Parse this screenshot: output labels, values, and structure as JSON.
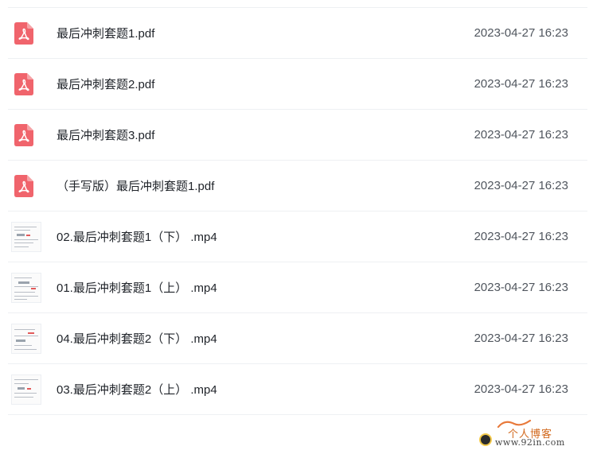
{
  "files": [
    {
      "type": "pdf",
      "icon": "pdf-file-icon",
      "name": "最后冲刺套题1.pdf",
      "date": "2023-04-27 16:23"
    },
    {
      "type": "pdf",
      "icon": "pdf-file-icon",
      "name": "最后冲刺套题2.pdf",
      "date": "2023-04-27 16:23"
    },
    {
      "type": "pdf",
      "icon": "pdf-file-icon",
      "name": "最后冲刺套题3.pdf",
      "date": "2023-04-27 16:23"
    },
    {
      "type": "pdf",
      "icon": "pdf-file-icon",
      "name": "（手写版）最后冲刺套题1.pdf",
      "date": "2023-04-27 16:23"
    },
    {
      "type": "video",
      "icon": "video-thumbnail",
      "name": "02.最后冲刺套题1（下） .mp4",
      "date": "2023-04-27 16:23"
    },
    {
      "type": "video",
      "icon": "video-thumbnail",
      "name": "01.最后冲刺套题1（上） .mp4",
      "date": "2023-04-27 16:23"
    },
    {
      "type": "video",
      "icon": "video-thumbnail",
      "name": "04.最后冲刺套题2（下） .mp4",
      "date": "2023-04-27 16:23"
    },
    {
      "type": "video",
      "icon": "video-thumbnail",
      "name": "03.最后冲刺套题2（上） .mp4",
      "date": "2023-04-27 16:23"
    }
  ],
  "watermark": {
    "title": "个人博客",
    "url": "www.92in.com"
  },
  "colors": {
    "pdf_icon": "#f0646c",
    "divider": "#eef0f3",
    "text": "#1f2329",
    "date_text": "#50565e"
  }
}
